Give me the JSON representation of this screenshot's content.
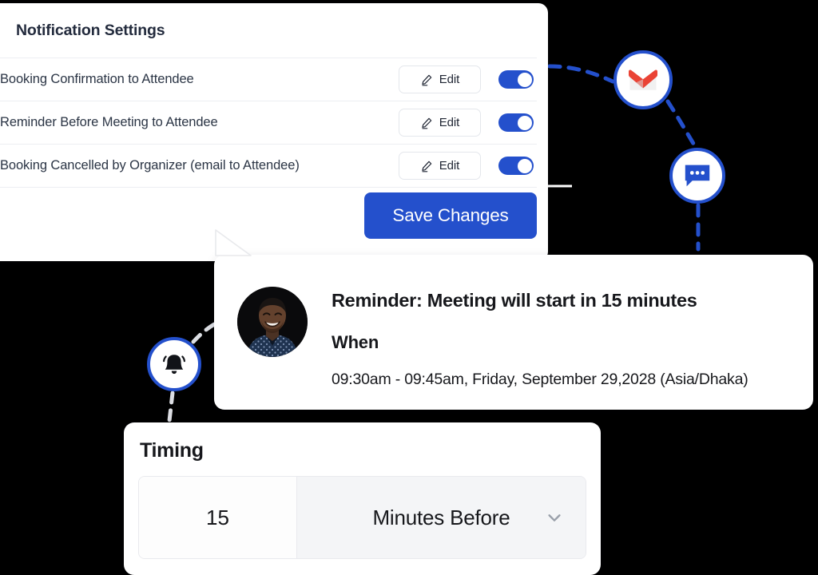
{
  "settings": {
    "title": "Notification Settings",
    "rows": [
      {
        "label": "Booking Confirmation to Attendee",
        "edit_label": "Edit",
        "enabled": true
      },
      {
        "label": "Reminder Before Meeting to Attendee",
        "edit_label": "Edit",
        "enabled": true
      },
      {
        "label": "Booking Cancelled by Organizer (email to Attendee)",
        "edit_label": "Edit",
        "enabled": true
      }
    ],
    "save_label": "Save Changes"
  },
  "badges": {
    "gmail": "gmail-icon",
    "chat": "chat-bubble-icon",
    "bell": "bell-icon"
  },
  "reminder": {
    "title": "Reminder: Meeting will start in 15 minutes",
    "when_label": "When",
    "datetime": "09:30am  - 09:45am, Friday, September 29,2028 (Asia/Dhaka)"
  },
  "timing": {
    "title": "Timing",
    "amount": "15",
    "unit": "Minutes Before"
  },
  "colors": {
    "accent_blue": "#2450cc",
    "gmail_red": "#ea4335",
    "panel_white": "#ffffff",
    "text_dark": "#17181c",
    "row_text": "#2b3545",
    "field_gray": "#f4f5f7"
  }
}
